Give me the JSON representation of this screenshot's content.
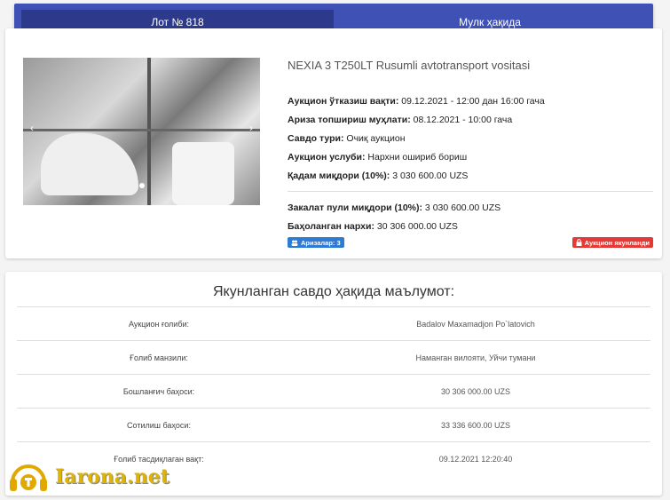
{
  "tabs": [
    {
      "label": "Лот № 818"
    },
    {
      "label": "Мулк ҳақида"
    }
  ],
  "lot": {
    "title": "NEXIA 3 T250LT Rusumli avtotransport vositasi",
    "rows1": [
      {
        "label": "Аукцион ўтказиш вақти:",
        "value": " 09.12.2021 - 12:00 дан 16:00 гача"
      },
      {
        "label": "Ариза топшириш муҳлати:",
        "value": " 08.12.2021 - 10:00 гача"
      },
      {
        "label": "Савдо тури:",
        "value": " Очиқ аукцион"
      },
      {
        "label": "Аукцион услуби:",
        "value": " Нархни ошириб бориш"
      },
      {
        "label": "Қадам миқдори (10%):",
        "value": " 3 030 600.00 UZS"
      }
    ],
    "rows2": [
      {
        "label": "Закалат пули миқдори (10%):",
        "value": " 3 030 600.00 UZS"
      },
      {
        "label": "Баҳоланган нархи:",
        "value": " 30 306 000.00 UZS"
      }
    ],
    "badge_applications": "Аризалар: 3",
    "badge_status": "Аукцион якунланди",
    "prev_arrow": "‹",
    "next_arrow": "›"
  },
  "summary": {
    "title": "Якунланган савдо ҳақида маълумот:",
    "rows": [
      {
        "label": "Аукцион ғолиби:",
        "value": "Badalov Maxamadjon Po`latovich"
      },
      {
        "label": "Ғолиб манзили:",
        "value": "Наманган вилояти, Уйчи тумани"
      },
      {
        "label": "Бошланғич баҳоси:",
        "value": "30 306 000.00 UZS"
      },
      {
        "label": "Сотилиш баҳоси:",
        "value": "33 336 600.00 UZS"
      },
      {
        "label": "Ғолиб тасдиқлаган вақт:",
        "value": "09.12.2021 12:20:40"
      }
    ]
  },
  "watermark": {
    "text": "Iarona.net"
  },
  "colors": {
    "header": "#3f51b5",
    "badge_blue": "#2e7bd6",
    "badge_red": "#e53935"
  }
}
